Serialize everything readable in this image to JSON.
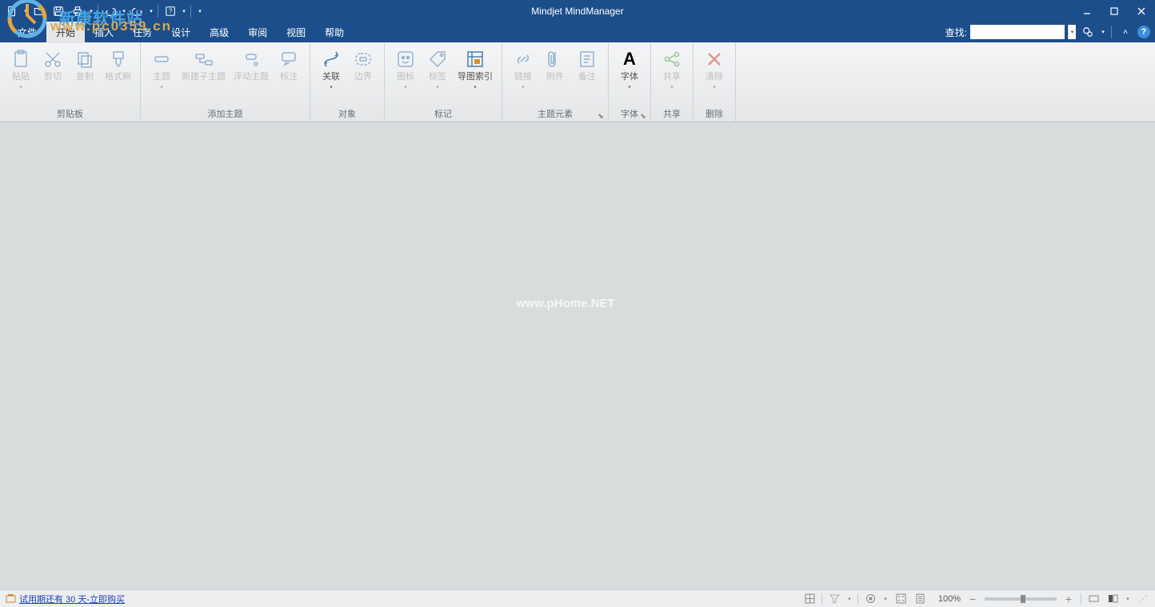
{
  "app": {
    "title": "Mindjet MindManager"
  },
  "qat": {
    "tips": {
      "new": "新建",
      "open": "打开",
      "save": "保存",
      "print": "打印",
      "undo": "撤销",
      "redo": "重做",
      "help": "帮助"
    }
  },
  "window": {
    "min": "最小化",
    "max": "最大化",
    "close": "关闭"
  },
  "menu": {
    "items": [
      "文件",
      "开始",
      "插入",
      "任务",
      "设计",
      "高级",
      "审阅",
      "视图",
      "帮助"
    ],
    "active_index": 1
  },
  "search": {
    "label": "查找:",
    "value": "",
    "placeholder": ""
  },
  "ribbon": {
    "groups": [
      {
        "name": "剪贴板",
        "buttons": [
          {
            "label": "粘贴",
            "hasDrop": true,
            "disabled": true,
            "icon": "paste"
          },
          {
            "label": "剪切",
            "hasDrop": false,
            "disabled": true,
            "icon": "cut"
          },
          {
            "label": "复制",
            "hasDrop": false,
            "disabled": true,
            "icon": "copy"
          },
          {
            "label": "格式刷",
            "hasDrop": false,
            "disabled": true,
            "icon": "brush"
          }
        ]
      },
      {
        "name": "添加主题",
        "buttons": [
          {
            "label": "主题",
            "hasDrop": true,
            "disabled": true,
            "icon": "topic"
          },
          {
            "label": "新建子主题",
            "hasDrop": false,
            "disabled": true,
            "icon": "subtopic"
          },
          {
            "label": "浮动主题",
            "hasDrop": false,
            "disabled": true,
            "icon": "float"
          },
          {
            "label": "标注",
            "hasDrop": false,
            "disabled": true,
            "icon": "callout"
          }
        ]
      },
      {
        "name": "对象",
        "buttons": [
          {
            "label": "关联",
            "hasDrop": true,
            "disabled": false,
            "icon": "relation"
          },
          {
            "label": "边界",
            "hasDrop": false,
            "disabled": true,
            "icon": "boundary"
          }
        ]
      },
      {
        "name": "标记",
        "buttons": [
          {
            "label": "图标",
            "hasDrop": true,
            "disabled": true,
            "icon": "iconmark"
          },
          {
            "label": "标签",
            "hasDrop": true,
            "disabled": true,
            "icon": "tag"
          },
          {
            "label": "导图索引",
            "hasDrop": true,
            "disabled": false,
            "icon": "index"
          }
        ]
      },
      {
        "name": "主题元素",
        "launcher": true,
        "buttons": [
          {
            "label": "链接",
            "hasDrop": true,
            "disabled": true,
            "icon": "link"
          },
          {
            "label": "附件",
            "hasDrop": false,
            "disabled": true,
            "icon": "attach"
          },
          {
            "label": "备注",
            "hasDrop": false,
            "disabled": true,
            "icon": "notes"
          }
        ]
      },
      {
        "name": "字体",
        "launcher": true,
        "buttons": [
          {
            "label": "字体",
            "hasDrop": true,
            "disabled": false,
            "icon": "font",
            "dark": true
          }
        ]
      },
      {
        "name": "共享",
        "buttons": [
          {
            "label": "共享",
            "hasDrop": true,
            "disabled": true,
            "icon": "share"
          }
        ]
      },
      {
        "name": "删除",
        "buttons": [
          {
            "label": "清除",
            "hasDrop": true,
            "disabled": true,
            "icon": "clear"
          }
        ]
      }
    ]
  },
  "watermarks": {
    "url": "www.pc0359.cn",
    "brand": "新康软件站",
    "center": "www.pHome.NET"
  },
  "status": {
    "trial": "试用期还有 30 天-立即购买",
    "zoom": "100%"
  }
}
